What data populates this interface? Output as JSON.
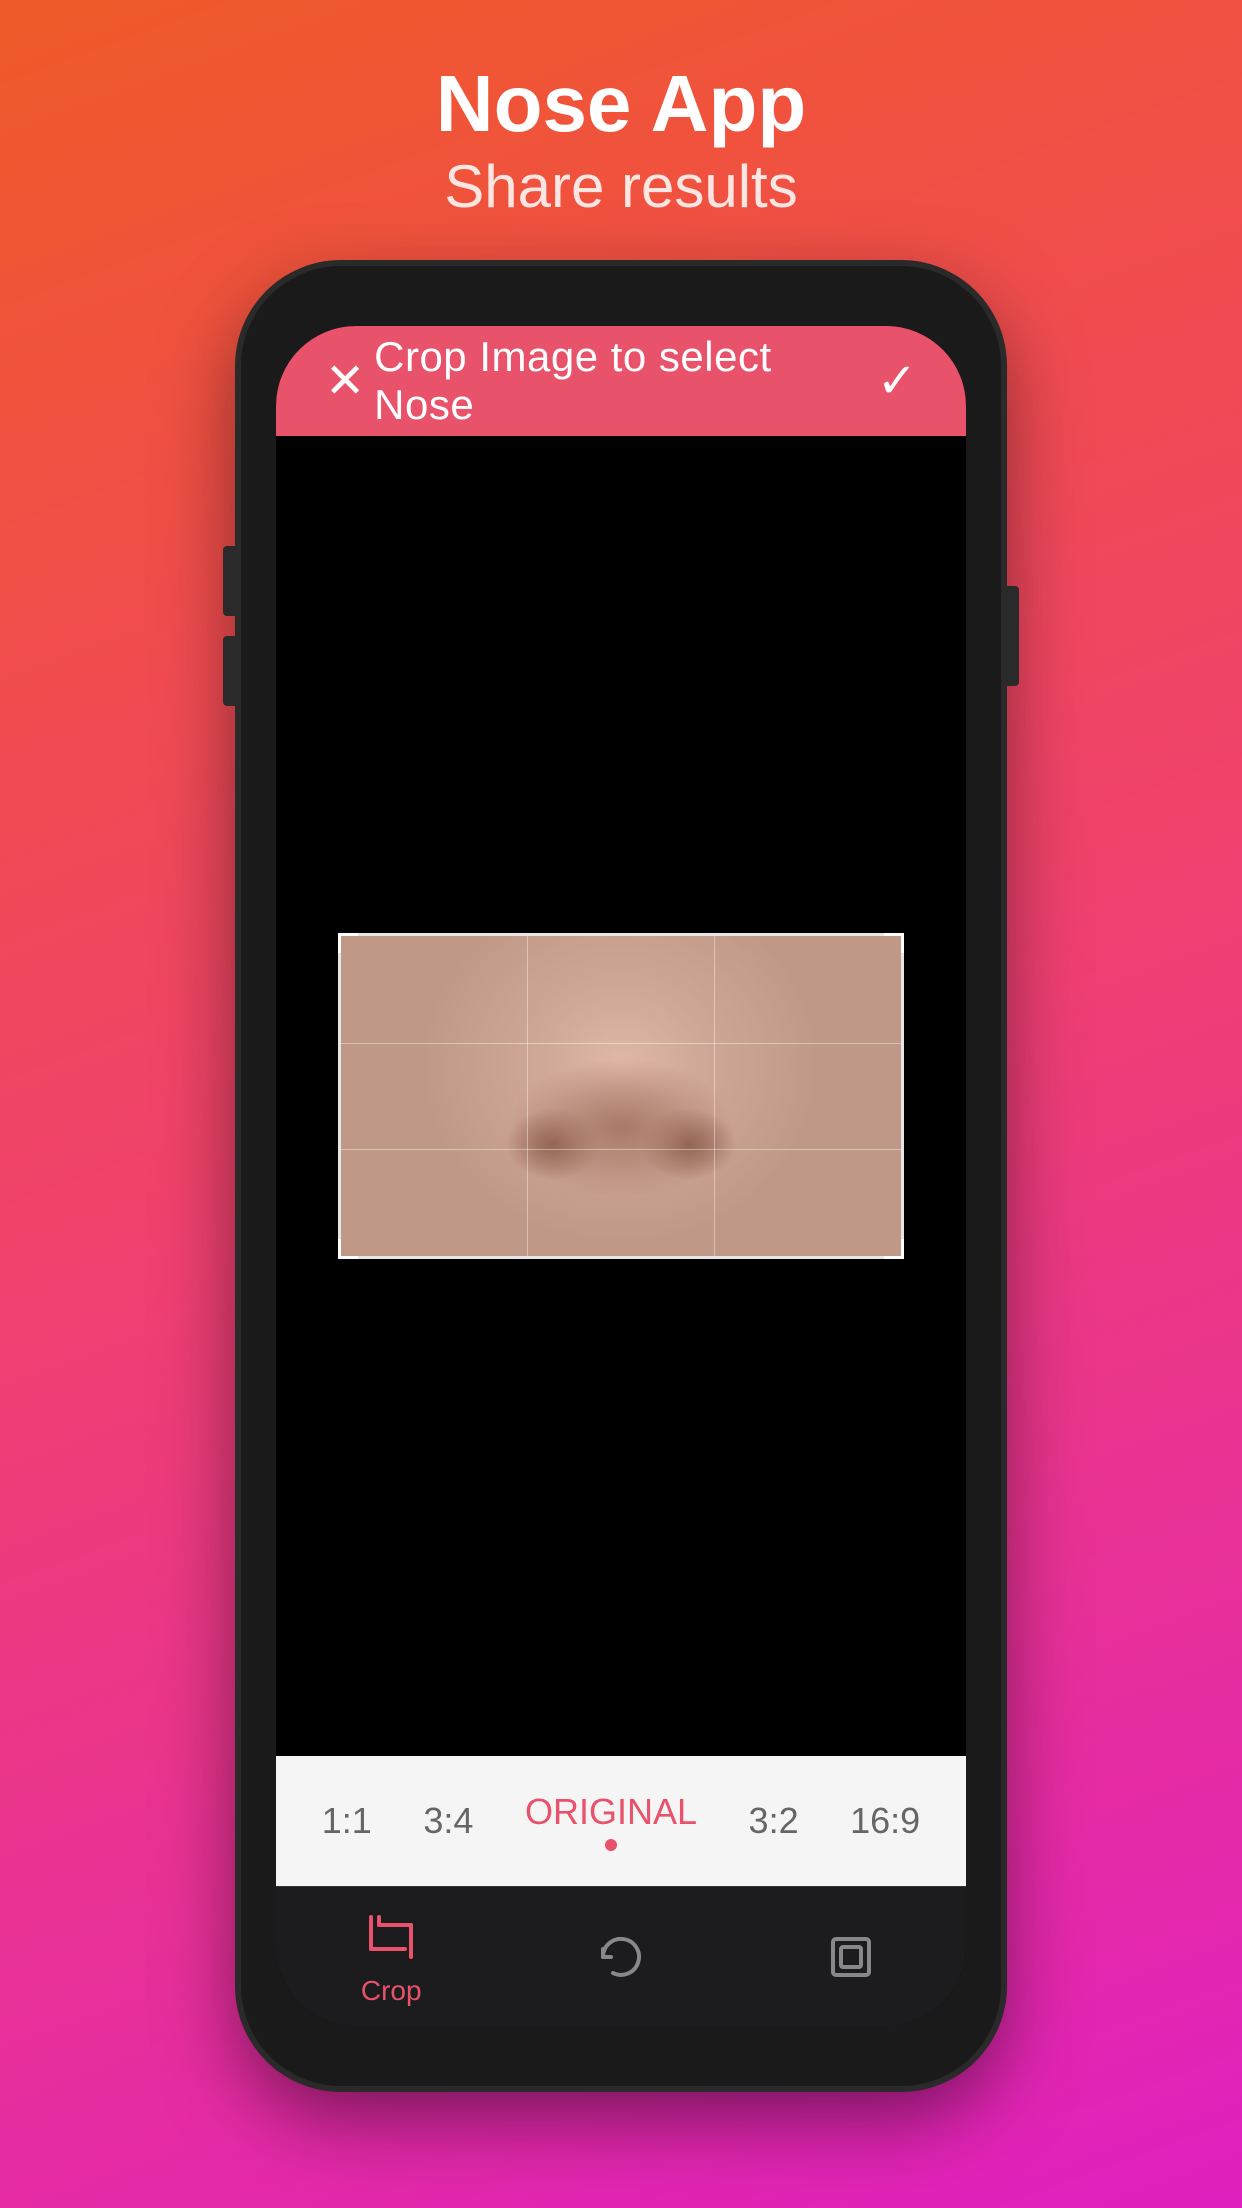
{
  "header": {
    "app_title": "Nose App",
    "app_subtitle": "Share results"
  },
  "screen": {
    "topbar": {
      "title": "Crop Image to select Nose",
      "close_label": "×",
      "confirm_label": "✓"
    },
    "ratio_options": [
      {
        "id": "1_1",
        "label": "1:1",
        "active": false
      },
      {
        "id": "3_4",
        "label": "3:4",
        "active": false
      },
      {
        "id": "original",
        "label": "ORIGINAL",
        "active": true
      },
      {
        "id": "3_2",
        "label": "3:2",
        "active": false
      },
      {
        "id": "16_9",
        "label": "16:9",
        "active": false
      }
    ],
    "toolbar": {
      "crop_label": "Crop",
      "refresh_label": "",
      "expand_label": ""
    }
  },
  "colors": {
    "accent": "#e8526a",
    "background_gradient_start": "#f05a28",
    "background_gradient_end": "#e020c0",
    "header_bar": "#e8526a",
    "phone_body": "#1a1a1a",
    "canvas_bg": "#000000",
    "ratio_bar_bg": "#f5f5f5",
    "toolbar_bg": "#1c1c1e"
  }
}
